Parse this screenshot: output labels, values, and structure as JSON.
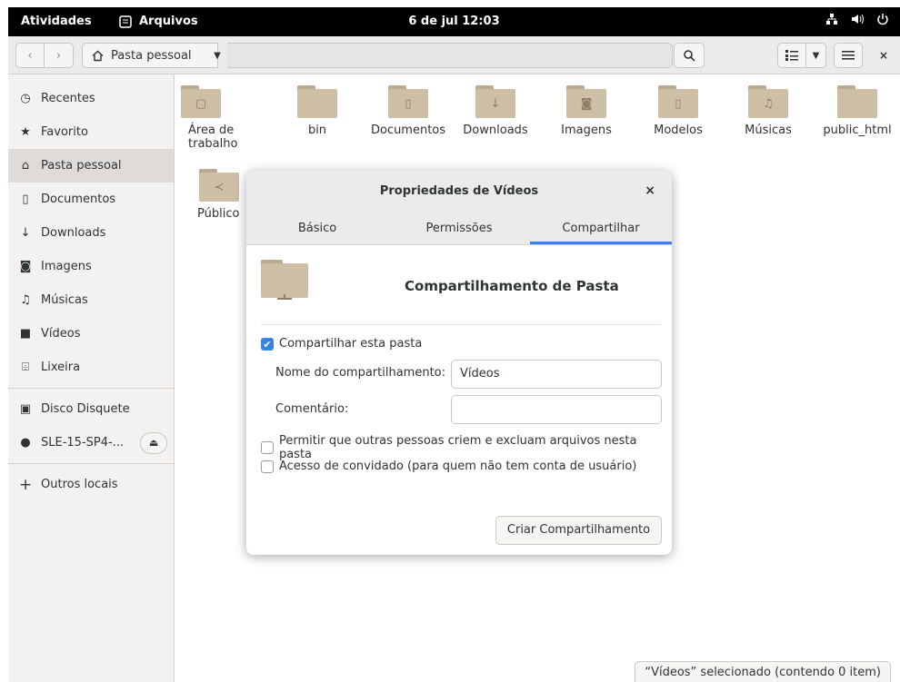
{
  "topbar": {
    "activities": "Atividades",
    "app_name": "Arquivos",
    "clock": "6 de jul 12:03"
  },
  "headerbar": {
    "path_label": "Pasta pessoal"
  },
  "sidebar": {
    "items": [
      {
        "label": "Recentes",
        "icon": "clock-icon"
      },
      {
        "label": "Favorito",
        "icon": "star-icon"
      },
      {
        "label": "Pasta pessoal",
        "icon": "home-icon"
      },
      {
        "label": "Documentos",
        "icon": "document-icon"
      },
      {
        "label": "Downloads",
        "icon": "download-icon"
      },
      {
        "label": "Imagens",
        "icon": "camera-icon"
      },
      {
        "label": "Músicas",
        "icon": "music-icon"
      },
      {
        "label": "Vídeos",
        "icon": "video-icon"
      },
      {
        "label": "Lixeira",
        "icon": "trash-icon"
      }
    ],
    "devices": [
      {
        "label": "Disco Disquete",
        "icon": "floppy-icon"
      },
      {
        "label": "SLE-15-SP4-...",
        "icon": "disc-icon"
      }
    ],
    "other": {
      "label": "Outros locais",
      "icon": "plus-icon"
    }
  },
  "files": [
    {
      "name": "Área de trabalho",
      "glyph": "▢"
    },
    {
      "name": "bin",
      "glyph": ""
    },
    {
      "name": "Documentos",
      "glyph": "▯"
    },
    {
      "name": "Downloads",
      "glyph": "↓"
    },
    {
      "name": "Imagens",
      "glyph": "◙"
    },
    {
      "name": "Modelos",
      "glyph": "▯"
    },
    {
      "name": "Músicas",
      "glyph": "♫"
    },
    {
      "name": "public_html",
      "glyph": ""
    },
    {
      "name": "Público",
      "glyph": "≺"
    }
  ],
  "status": "“Vídeos” selecionado  (contendo 0 item)",
  "dialog": {
    "title": "Propriedades de Vídeos",
    "tabs": [
      "Básico",
      "Permissões",
      "Compartilhar"
    ],
    "share_title": "Compartilhamento de Pasta",
    "share_checkbox": "Compartilhar esta pasta",
    "share_name_label": "Nome do compartilhamento:",
    "share_name_value": "Vídeos",
    "comment_label": "Comentário:",
    "comment_value": "",
    "allow_label": "Permitir que outras pessoas criem e excluam arquivos nesta pasta",
    "guest_label": "Acesso de convidado (para quem não tem conta de usuário)",
    "create_button": "Criar Compartilhamento"
  }
}
